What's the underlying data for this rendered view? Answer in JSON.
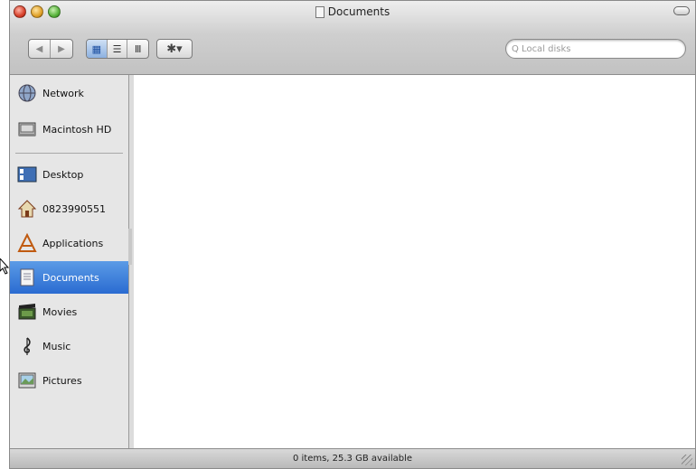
{
  "window": {
    "title": "Documents"
  },
  "toolbar": {
    "back_label": "◀",
    "forward_label": "▶",
    "view_icon_label": "▦",
    "view_list_label": "☰",
    "view_column_label": "Ⅲ",
    "action_label": "✱▾",
    "search_placeholder": "Q Local disks"
  },
  "sidebar": {
    "items": [
      {
        "label": "Network",
        "icon": "network-globe-icon"
      },
      {
        "label": "Macintosh HD",
        "icon": "hard-drive-icon"
      },
      {
        "label": "Desktop",
        "icon": "desktop-icon"
      },
      {
        "label": "0823990551",
        "icon": "home-icon"
      },
      {
        "label": "Applications",
        "icon": "applications-icon"
      },
      {
        "label": "Documents",
        "icon": "documents-icon",
        "selected": true
      },
      {
        "label": "Movies",
        "icon": "movies-icon"
      },
      {
        "label": "Music",
        "icon": "music-icon"
      },
      {
        "label": "Pictures",
        "icon": "pictures-icon"
      }
    ]
  },
  "statusbar": {
    "text": "0 items, 25.3 GB available"
  },
  "colors": {
    "selection": "#3478d8",
    "content_background": "#ffffff",
    "sidebar_background": "#e6e6e6"
  }
}
